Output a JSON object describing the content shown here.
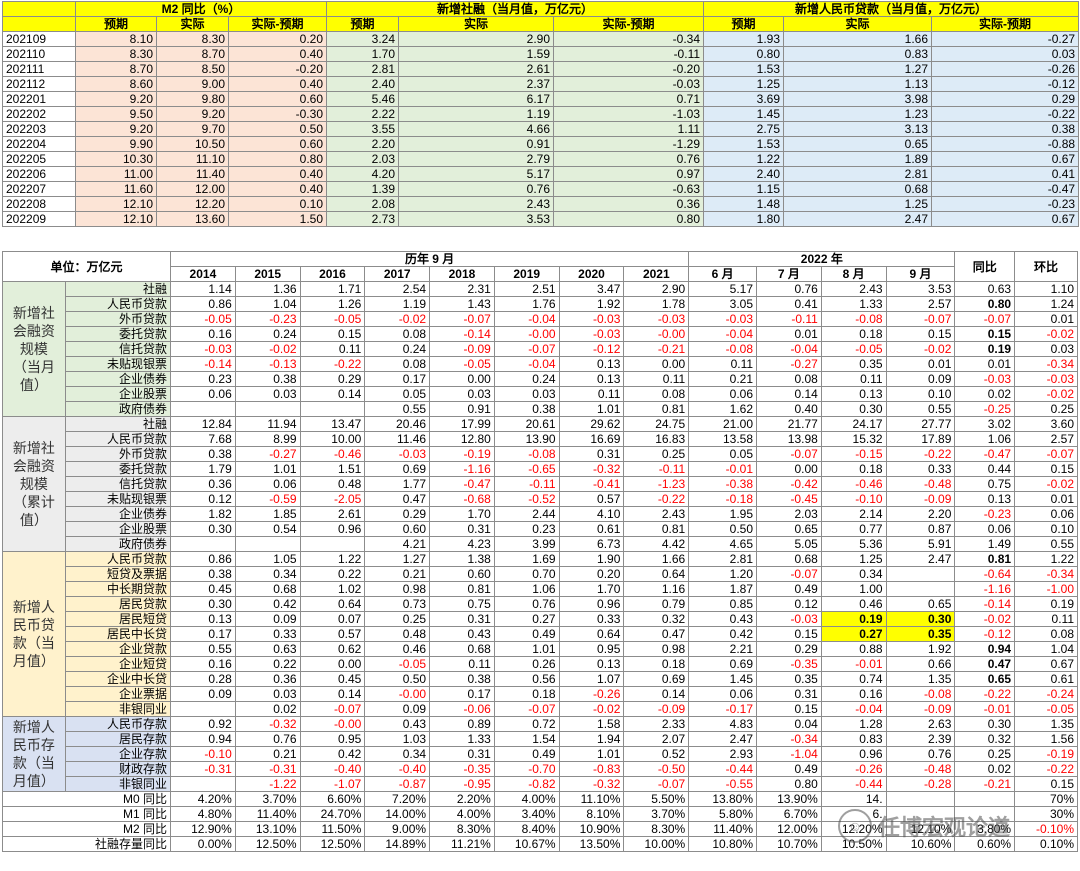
{
  "top_table": {
    "groups": [
      "M2 同比（%）",
      "新增社融（当月值，万亿元）",
      "新增人民币贷款（当月值，万亿元）"
    ],
    "subheaders": [
      "预期",
      "实际",
      "实际-预期",
      "预期",
      "实际",
      "实际-预期",
      "预期",
      "实际",
      "实际-预期"
    ],
    "rows": [
      [
        "202109",
        "8.10",
        "8.30",
        "0.20",
        "3.24",
        "2.90",
        "-0.34",
        "1.93",
        "1.66",
        "-0.27"
      ],
      [
        "202110",
        "8.30",
        "8.70",
        "0.40",
        "1.70",
        "1.59",
        "-0.11",
        "0.80",
        "0.83",
        "0.03"
      ],
      [
        "202111",
        "8.70",
        "8.50",
        "-0.20",
        "2.81",
        "2.61",
        "-0.20",
        "1.53",
        "1.27",
        "-0.26"
      ],
      [
        "202112",
        "8.60",
        "9.00",
        "0.40",
        "2.40",
        "2.37",
        "-0.03",
        "1.25",
        "1.13",
        "-0.12"
      ],
      [
        "202201",
        "9.20",
        "9.80",
        "0.60",
        "5.46",
        "6.17",
        "0.71",
        "3.69",
        "3.98",
        "0.29"
      ],
      [
        "202202",
        "9.50",
        "9.20",
        "-0.30",
        "2.22",
        "1.19",
        "-1.03",
        "1.45",
        "1.23",
        "-0.22"
      ],
      [
        "202203",
        "9.20",
        "9.70",
        "0.50",
        "3.55",
        "4.66",
        "1.11",
        "2.75",
        "3.13",
        "0.38"
      ],
      [
        "202204",
        "9.90",
        "10.50",
        "0.60",
        "2.20",
        "0.91",
        "-1.29",
        "1.53",
        "0.65",
        "-0.88"
      ],
      [
        "202205",
        "10.30",
        "11.10",
        "0.80",
        "2.03",
        "2.79",
        "0.76",
        "1.22",
        "1.89",
        "0.67"
      ],
      [
        "202206",
        "11.00",
        "11.40",
        "0.40",
        "4.20",
        "5.17",
        "0.97",
        "2.40",
        "2.81",
        "0.41"
      ],
      [
        "202207",
        "11.60",
        "12.00",
        "0.40",
        "1.39",
        "0.76",
        "-0.63",
        "1.15",
        "0.68",
        "-0.47"
      ],
      [
        "202208",
        "12.10",
        "12.20",
        "0.10",
        "2.08",
        "2.43",
        "0.36",
        "1.48",
        "1.25",
        "-0.23"
      ],
      [
        "202209",
        "12.10",
        "13.60",
        "1.50",
        "2.73",
        "3.53",
        "0.80",
        "1.80",
        "2.47",
        "0.67"
      ]
    ]
  },
  "main_table": {
    "unit_label": "单位：万亿元",
    "hist_title": "历年 9 月",
    "year2022_title": "2022 年",
    "yoy_label": "同比",
    "mom_label": "环比",
    "years": [
      "2014",
      "2015",
      "2016",
      "2017",
      "2018",
      "2019",
      "2020",
      "2021"
    ],
    "months": [
      "6 月",
      "7 月",
      "8 月",
      "9 月"
    ],
    "sections": [
      {
        "name": "新增社会融资规模（当月值）",
        "rows": [
          {
            "label": "社融",
            "v": [
              "1.14",
              "1.36",
              "1.71",
              "2.54",
              "2.31",
              "2.51",
              "3.47",
              "2.90",
              "5.17",
              "0.76",
              "2.43",
              "3.53",
              "0.63",
              "1.10"
            ]
          },
          {
            "label": "人民币贷款",
            "v": [
              "0.86",
              "1.04",
              "1.26",
              "1.19",
              "1.43",
              "1.76",
              "1.92",
              "1.78",
              "3.05",
              "0.41",
              "1.33",
              "2.57",
              "0.80",
              "1.24"
            ]
          },
          {
            "label": "外币贷款",
            "v": [
              "-0.05",
              "-0.23",
              "-0.05",
              "-0.02",
              "-0.07",
              "-0.04",
              "-0.03",
              "-0.03",
              "-0.03",
              "-0.11",
              "-0.08",
              "-0.07",
              "-0.07",
              "0.01"
            ]
          },
          {
            "label": "委托贷款",
            "v": [
              "0.16",
              "0.24",
              "0.15",
              "0.08",
              "-0.14",
              "-0.00",
              "-0.03",
              "-0.00",
              "-0.04",
              "0.01",
              "0.18",
              "0.15",
              "0.15",
              "-0.02"
            ]
          },
          {
            "label": "信托贷款",
            "v": [
              "-0.03",
              "-0.02",
              "0.11",
              "0.24",
              "-0.09",
              "-0.07",
              "-0.12",
              "-0.21",
              "-0.08",
              "-0.04",
              "-0.05",
              "-0.02",
              "0.19",
              "0.03"
            ]
          },
          {
            "label": "未贴现银票",
            "v": [
              "-0.14",
              "-0.13",
              "-0.22",
              "0.08",
              "-0.05",
              "-0.04",
              "0.13",
              "0.00",
              "0.11",
              "-0.27",
              "0.35",
              "0.01",
              "0.01",
              "-0.34"
            ]
          },
          {
            "label": "企业债券",
            "v": [
              "0.23",
              "0.38",
              "0.29",
              "0.17",
              "0.00",
              "0.24",
              "0.13",
              "0.11",
              "0.21",
              "0.08",
              "0.11",
              "0.09",
              "-0.03",
              "-0.03"
            ]
          },
          {
            "label": "企业股票",
            "v": [
              "0.06",
              "0.03",
              "0.14",
              "0.05",
              "0.03",
              "0.03",
              "0.11",
              "0.08",
              "0.06",
              "0.14",
              "0.13",
              "0.10",
              "0.02",
              "-0.02"
            ]
          },
          {
            "label": "政府债券",
            "v": [
              "",
              "",
              "",
              "0.55",
              "0.91",
              "0.38",
              "1.01",
              "0.81",
              "1.62",
              "0.40",
              "0.30",
              "0.55",
              "-0.25",
              "0.25"
            ]
          }
        ]
      },
      {
        "name": "新增社会融资规模（累计值）",
        "rows": [
          {
            "label": "社融",
            "v": [
              "12.84",
              "11.94",
              "13.47",
              "20.46",
              "17.99",
              "20.61",
              "29.62",
              "24.75",
              "21.00",
              "21.77",
              "24.17",
              "27.77",
              "3.02",
              "3.60"
            ]
          },
          {
            "label": "人民币贷款",
            "v": [
              "7.68",
              "8.99",
              "10.00",
              "11.46",
              "12.80",
              "13.90",
              "16.69",
              "16.83",
              "13.58",
              "13.98",
              "15.32",
              "17.89",
              "1.06",
              "2.57"
            ]
          },
          {
            "label": "外币贷款",
            "v": [
              "0.38",
              "-0.27",
              "-0.46",
              "-0.03",
              "-0.19",
              "-0.08",
              "0.31",
              "0.25",
              "0.05",
              "-0.07",
              "-0.15",
              "-0.22",
              "-0.47",
              "-0.07"
            ]
          },
          {
            "label": "委托贷款",
            "v": [
              "1.79",
              "1.01",
              "1.51",
              "0.69",
              "-1.16",
              "-0.65",
              "-0.32",
              "-0.11",
              "-0.01",
              "0.00",
              "0.18",
              "0.33",
              "0.44",
              "0.15"
            ]
          },
          {
            "label": "信托贷款",
            "v": [
              "0.36",
              "0.06",
              "0.48",
              "1.77",
              "-0.47",
              "-0.11",
              "-0.41",
              "-1.23",
              "-0.38",
              "-0.42",
              "-0.46",
              "-0.48",
              "0.75",
              "-0.02"
            ]
          },
          {
            "label": "未贴现银票",
            "v": [
              "0.12",
              "-0.59",
              "-2.05",
              "0.47",
              "-0.68",
              "-0.52",
              "0.57",
              "-0.22",
              "-0.18",
              "-0.45",
              "-0.10",
              "-0.09",
              "0.13",
              "0.01"
            ]
          },
          {
            "label": "企业债券",
            "v": [
              "1.82",
              "1.85",
              "2.61",
              "0.29",
              "1.70",
              "2.44",
              "4.10",
              "2.43",
              "1.95",
              "2.03",
              "2.14",
              "2.20",
              "-0.23",
              "0.06"
            ]
          },
          {
            "label": "企业股票",
            "v": [
              "0.30",
              "0.54",
              "0.96",
              "0.60",
              "0.31",
              "0.23",
              "0.61",
              "0.81",
              "0.50",
              "0.65",
              "0.77",
              "0.87",
              "0.06",
              "0.10"
            ]
          },
          {
            "label": "政府债券",
            "v": [
              "",
              "",
              "",
              "4.21",
              "4.23",
              "3.99",
              "6.73",
              "4.42",
              "4.65",
              "5.05",
              "5.36",
              "5.91",
              "1.49",
              "0.55"
            ]
          }
        ]
      },
      {
        "name": "新增人民币贷款（当月值）",
        "rows": [
          {
            "label": "人民币贷款",
            "v": [
              "0.86",
              "1.05",
              "1.22",
              "1.27",
              "1.38",
              "1.69",
              "1.90",
              "1.66",
              "2.81",
              "0.68",
              "1.25",
              "2.47",
              "0.81",
              "1.22"
            ]
          },
          {
            "label": "短贷及票据",
            "v": [
              "0.38",
              "0.34",
              "0.22",
              "0.21",
              "0.60",
              "0.70",
              "0.20",
              "0.64",
              "1.20",
              "-0.07",
              "0.34",
              "",
              "-0.64",
              "-0.34"
            ]
          },
          {
            "label": "中长期贷款",
            "v": [
              "0.45",
              "0.68",
              "1.02",
              "0.98",
              "0.81",
              "1.06",
              "1.70",
              "1.16",
              "1.87",
              "0.49",
              "1.00",
              "",
              "-1.16",
              "-1.00"
            ]
          },
          {
            "label": "居民贷款",
            "v": [
              "0.30",
              "0.42",
              "0.64",
              "0.73",
              "0.75",
              "0.76",
              "0.96",
              "0.79",
              "0.85",
              "0.12",
              "0.46",
              "0.65",
              "-0.14",
              "0.19"
            ]
          },
          {
            "label": "居民短贷",
            "v": [
              "0.13",
              "0.09",
              "0.07",
              "0.25",
              "0.31",
              "0.27",
              "0.33",
              "0.32",
              "0.43",
              "-0.03",
              "0.19",
              "0.30",
              "-0.02",
              "0.11"
            ]
          },
          {
            "label": "居民中长贷",
            "v": [
              "0.17",
              "0.33",
              "0.57",
              "0.48",
              "0.43",
              "0.49",
              "0.64",
              "0.47",
              "0.42",
              "0.15",
              "0.27",
              "0.35",
              "-0.12",
              "0.08"
            ]
          },
          {
            "label": "企业贷款",
            "v": [
              "0.55",
              "0.63",
              "0.62",
              "0.46",
              "0.68",
              "1.01",
              "0.95",
              "0.98",
              "2.21",
              "0.29",
              "0.88",
              "1.92",
              "0.94",
              "1.04"
            ]
          },
          {
            "label": "企业短贷",
            "v": [
              "0.16",
              "0.22",
              "0.00",
              "-0.05",
              "0.11",
              "0.26",
              "0.13",
              "0.18",
              "0.69",
              "-0.35",
              "-0.01",
              "0.66",
              "0.47",
              "0.67"
            ]
          },
          {
            "label": "企业中长贷",
            "v": [
              "0.28",
              "0.36",
              "0.45",
              "0.50",
              "0.38",
              "0.56",
              "1.07",
              "0.69",
              "1.45",
              "0.35",
              "0.74",
              "1.35",
              "0.65",
              "0.61"
            ]
          },
          {
            "label": "企业票据",
            "v": [
              "0.09",
              "0.03",
              "0.14",
              "-0.00",
              "0.17",
              "0.18",
              "-0.26",
              "0.14",
              "0.06",
              "0.31",
              "0.16",
              "-0.08",
              "-0.22",
              "-0.24"
            ]
          },
          {
            "label": "非银同业",
            "v": [
              "",
              "0.02",
              "-0.07",
              "0.09",
              "-0.06",
              "-0.07",
              "-0.02",
              "-0.09",
              "-0.17",
              "0.15",
              "-0.04",
              "-0.09",
              "-0.01",
              "-0.05"
            ]
          }
        ]
      },
      {
        "name": "新增人民币存款（当月值）",
        "rows": [
          {
            "label": "人民币存款",
            "v": [
              "0.92",
              "-0.32",
              "-0.00",
              "0.43",
              "0.89",
              "0.72",
              "1.58",
              "2.33",
              "4.83",
              "0.04",
              "1.28",
              "2.63",
              "0.30",
              "1.35"
            ]
          },
          {
            "label": "居民存款",
            "v": [
              "0.94",
              "0.76",
              "0.95",
              "1.03",
              "1.33",
              "1.54",
              "1.94",
              "2.07",
              "2.47",
              "-0.34",
              "0.83",
              "2.39",
              "0.32",
              "1.56"
            ]
          },
          {
            "label": "企业存款",
            "v": [
              "-0.10",
              "0.21",
              "0.42",
              "0.34",
              "0.31",
              "0.49",
              "1.01",
              "0.52",
              "2.93",
              "-1.04",
              "0.96",
              "0.76",
              "0.25",
              "-0.19"
            ]
          },
          {
            "label": "财政存款",
            "v": [
              "-0.31",
              "-0.31",
              "-0.40",
              "-0.40",
              "-0.35",
              "-0.70",
              "-0.83",
              "-0.50",
              "-0.44",
              "0.49",
              "-0.26",
              "-0.48",
              "0.02",
              "-0.22"
            ]
          },
          {
            "label": "非银同业",
            "v": [
              "",
              "-1.22",
              "-1.07",
              "-0.87",
              "-0.95",
              "-0.82",
              "-0.32",
              "-0.07",
              "-0.55",
              "0.80",
              "-0.44",
              "-0.28",
              "-0.21",
              "0.15"
            ]
          }
        ]
      }
    ],
    "bottom_rows": [
      {
        "label": "M0 同比",
        "v": [
          "4.20%",
          "3.70%",
          "6.60%",
          "7.20%",
          "2.20%",
          "4.00%",
          "11.10%",
          "5.50%",
          "13.80%",
          "13.90%",
          "14.",
          "",
          "",
          "70%"
        ]
      },
      {
        "label": "M1 同比",
        "v": [
          "4.80%",
          "11.40%",
          "24.70%",
          "14.00%",
          "4.00%",
          "3.40%",
          "8.10%",
          "3.70%",
          "5.80%",
          "6.70%",
          "6.",
          "",
          "",
          "30%"
        ]
      },
      {
        "label": "M2 同比",
        "v": [
          "12.90%",
          "13.10%",
          "11.50%",
          "9.00%",
          "8.30%",
          "8.40%",
          "10.90%",
          "8.30%",
          "11.40%",
          "12.00%",
          "12.20%",
          "12.10%",
          "3.80%",
          "-0.10%"
        ]
      },
      {
        "label": "社融存量同比",
        "v": [
          "0.00%",
          "12.50%",
          "12.50%",
          "14.89%",
          "11.21%",
          "10.67%",
          "13.50%",
          "10.00%",
          "10.80%",
          "10.70%",
          "10.50%",
          "10.60%",
          "0.60%",
          "0.10%"
        ]
      }
    ]
  },
  "highlights": {
    "bold_yoy": [
      "0.80",
      "0.15",
      "0.19",
      "0.81",
      "0.94",
      "0.47",
      "0.65"
    ]
  },
  "colors": {
    "header_yellow": "#ffff00",
    "negative_red": "#ff0000",
    "m2_bg": "#fce4d6",
    "sf_bg": "#e2efda",
    "loan_bg": "#ddebf7"
  },
  "watermark": {
    "text": "任博宏观论道"
  }
}
